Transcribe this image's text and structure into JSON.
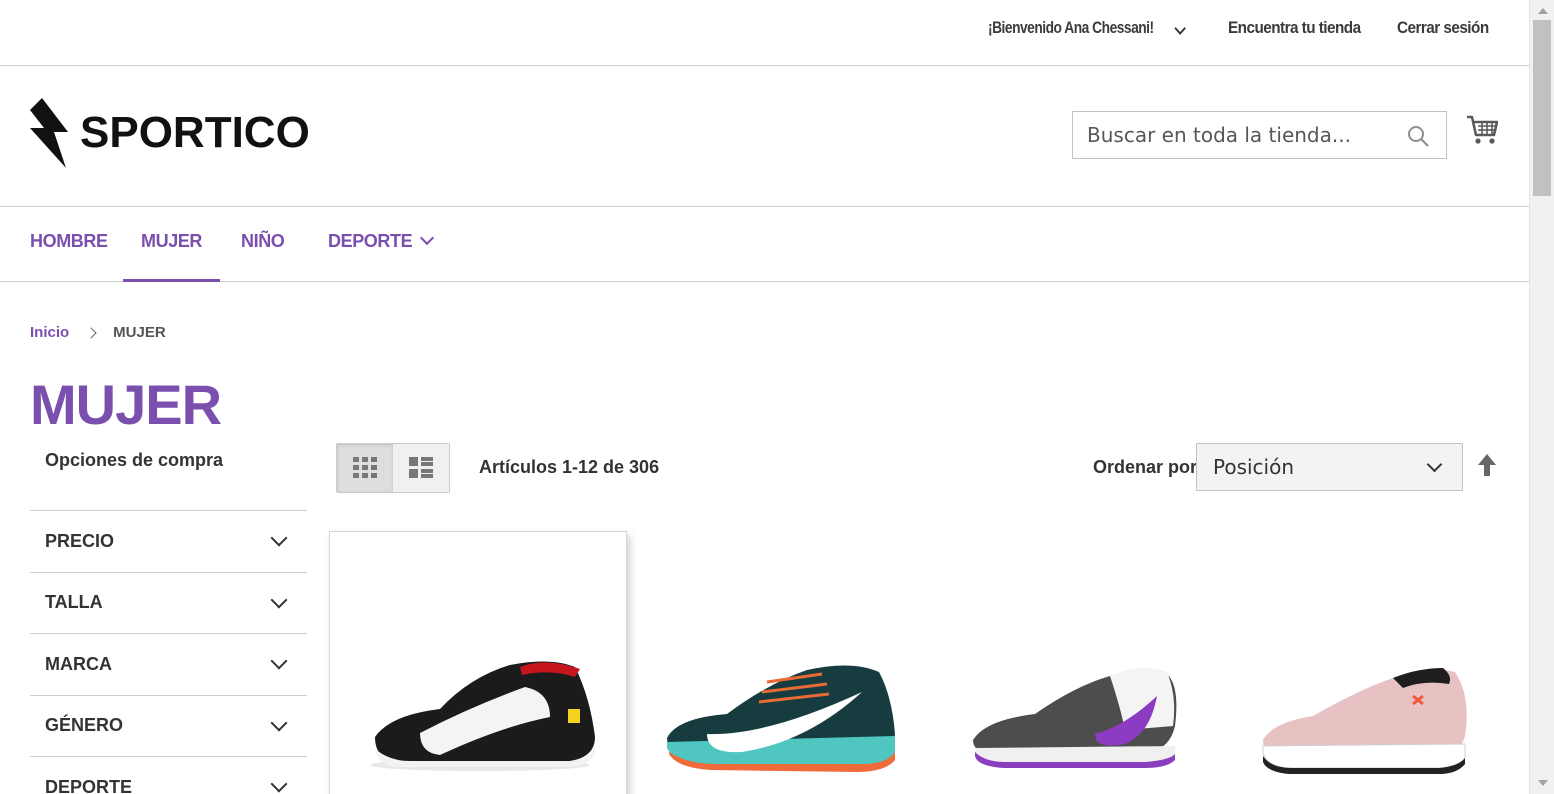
{
  "top_links": {
    "welcome": "¡Bienvenido Ana Chessani!",
    "find_store": "Encuentra tu tienda",
    "logout": "Cerrar sesión"
  },
  "brand": {
    "name": "SPORTICO"
  },
  "search": {
    "placeholder": "Buscar en toda la tienda..."
  },
  "nav": {
    "items": [
      {
        "label": "HOMBRE"
      },
      {
        "label": "MUJER"
      },
      {
        "label": "NIÑO"
      },
      {
        "label": "DEPORTE"
      }
    ],
    "active": "MUJER"
  },
  "breadcrumb": {
    "home": "Inicio",
    "current": "MUJER"
  },
  "page_title": "MUJER",
  "sidebar": {
    "heading": "Opciones de compra",
    "filters": [
      {
        "label": "PRECIO"
      },
      {
        "label": "TALLA"
      },
      {
        "label": "MARCA"
      },
      {
        "label": "GÉNERO"
      },
      {
        "label": "DEPORTE"
      }
    ]
  },
  "toolbar": {
    "count": "Artículos 1-12 de 306",
    "sort_label": "Ordenar por",
    "sort_value": "Posición",
    "view_mode": "grid"
  },
  "products": [
    {
      "image": "puma-ferrari-black-sneaker"
    },
    {
      "image": "nike-zoom-pegasus-teal-sneaker"
    },
    {
      "image": "nike-zoom-winflo-grey-purple-sneaker"
    },
    {
      "image": "under-armour-pink-sneaker"
    }
  ],
  "colors": {
    "accent": "#7a4fae",
    "text": "#333333",
    "border": "#cfcfcf"
  }
}
